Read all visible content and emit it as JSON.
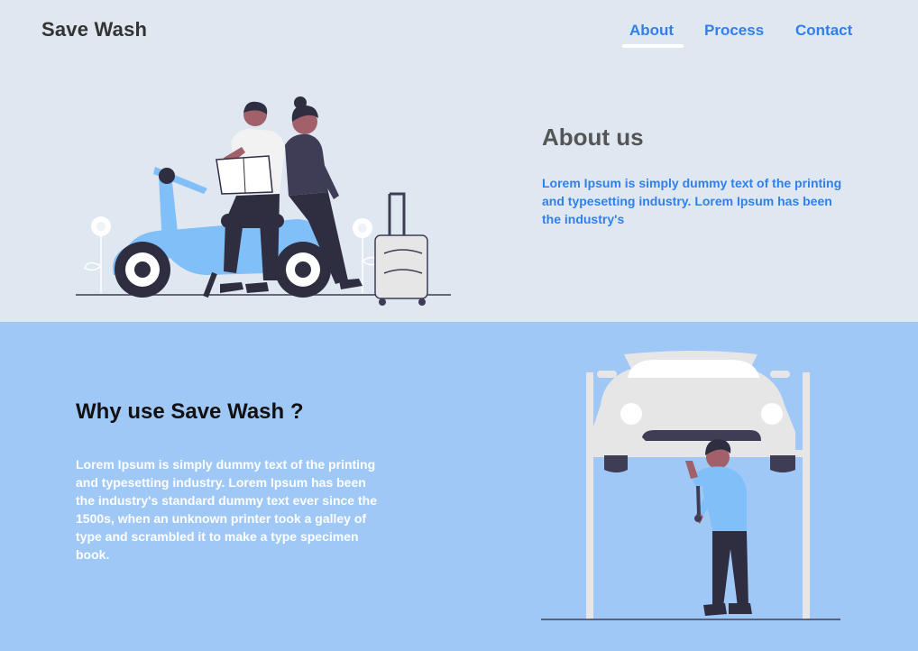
{
  "brand": "Save Wash",
  "nav": {
    "items": [
      {
        "label": "About",
        "active": true
      },
      {
        "label": "Process",
        "active": false
      },
      {
        "label": "Contact",
        "active": false
      }
    ]
  },
  "about": {
    "title": "About us",
    "text": "Lorem Ipsum is simply dummy text of the printing and typesetting industry. Lorem Ipsum has been the industry's"
  },
  "why": {
    "title": "Why use Save Wash ?",
    "text": "Lorem Ipsum is simply dummy text of the printing and typesetting industry. Lorem Ipsum has been the industry's standard dummy text ever since the 1500s, when an unknown printer took a galley of type and scrambled it to make a type specimen book."
  },
  "colors": {
    "accent": "#2f80ed",
    "top_background": "#dfe7f1",
    "bottom_background": "#a0c8f6",
    "scooter": "#80bff8",
    "dark": "#2f2e41"
  },
  "illustrations": {
    "hero": "scooter-couple-illustration",
    "mechanic": "car-lift-mechanic-illustration"
  }
}
